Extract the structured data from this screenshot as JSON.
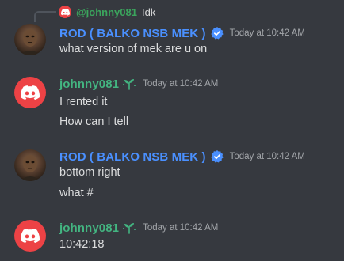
{
  "reply": {
    "mention": "@johnny081",
    "text": "Idk"
  },
  "messages": [
    {
      "author": "ROD ( BALKO NSB MEK )",
      "timestamp": "Today at 10:42 AM",
      "lines": [
        "what version of mek are u on"
      ]
    },
    {
      "author": "johnny081",
      "timestamp": "Today at 10:42 AM",
      "lines": [
        "I rented it",
        "How can I tell"
      ]
    },
    {
      "author": "ROD ( BALKO NSB MEK )",
      "timestamp": "Today at 10:42 AM",
      "lines": [
        "bottom right",
        "what #"
      ]
    },
    {
      "author": "johnny081",
      "timestamp": "Today at 10:42 AM",
      "lines": [
        "10:42:18"
      ]
    }
  ],
  "colors": {
    "background": "#36393f",
    "rod_name": "#4a90ff",
    "johnny_name": "#43b581",
    "discord_red": "#ed4245"
  },
  "icons": [
    "discord-logo-icon",
    "verified-badge-icon",
    "sprout-badge-icon"
  ]
}
